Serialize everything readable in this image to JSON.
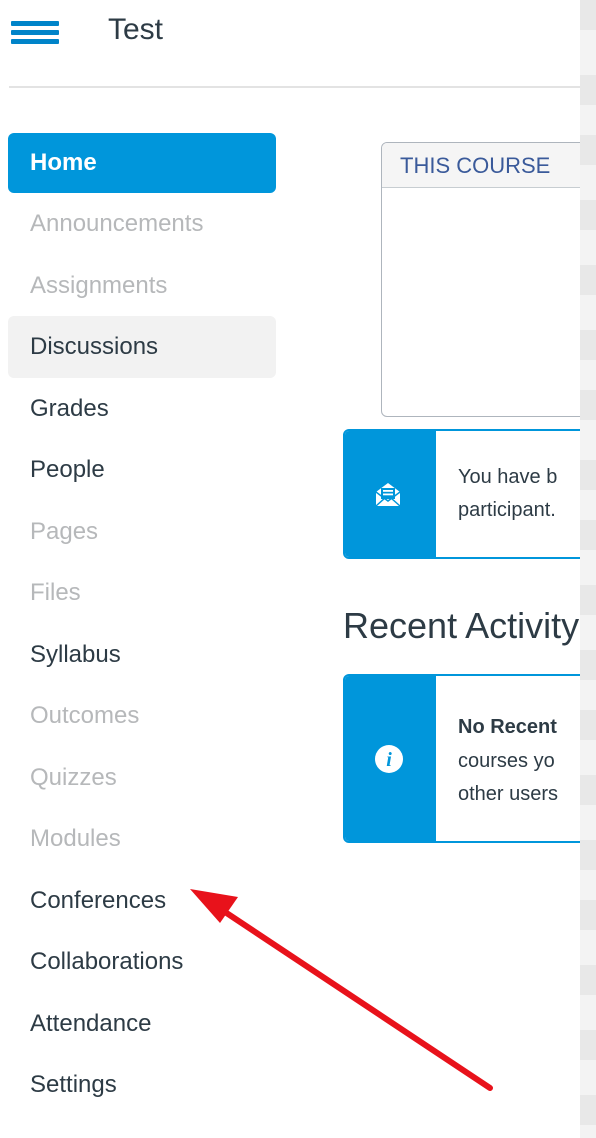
{
  "header": {
    "title": "Test"
  },
  "nav": {
    "items": [
      {
        "label": "Home",
        "state": "active"
      },
      {
        "label": "Announcements",
        "state": "disabled"
      },
      {
        "label": "Assignments",
        "state": "disabled"
      },
      {
        "label": "Discussions",
        "state": "hover"
      },
      {
        "label": "Grades",
        "state": "enabled"
      },
      {
        "label": "People",
        "state": "enabled"
      },
      {
        "label": "Pages",
        "state": "disabled"
      },
      {
        "label": "Files",
        "state": "disabled"
      },
      {
        "label": "Syllabus",
        "state": "enabled"
      },
      {
        "label": "Outcomes",
        "state": "disabled"
      },
      {
        "label": "Quizzes",
        "state": "disabled"
      },
      {
        "label": "Modules",
        "state": "disabled"
      },
      {
        "label": "Conferences",
        "state": "enabled"
      },
      {
        "label": "Collaborations",
        "state": "enabled"
      },
      {
        "label": "Attendance",
        "state": "enabled"
      },
      {
        "label": "Settings",
        "state": "enabled"
      }
    ]
  },
  "course_box": {
    "header": "THIS COURSE"
  },
  "invite_alert": {
    "line1": "You have b",
    "line2": "participant."
  },
  "recent_activity": {
    "heading": "Recent Activity",
    "title": "No Recent",
    "line2": "courses yo",
    "line3": "other users"
  },
  "colors": {
    "accent": "#0096db",
    "annotation_arrow": "#e8121b"
  }
}
